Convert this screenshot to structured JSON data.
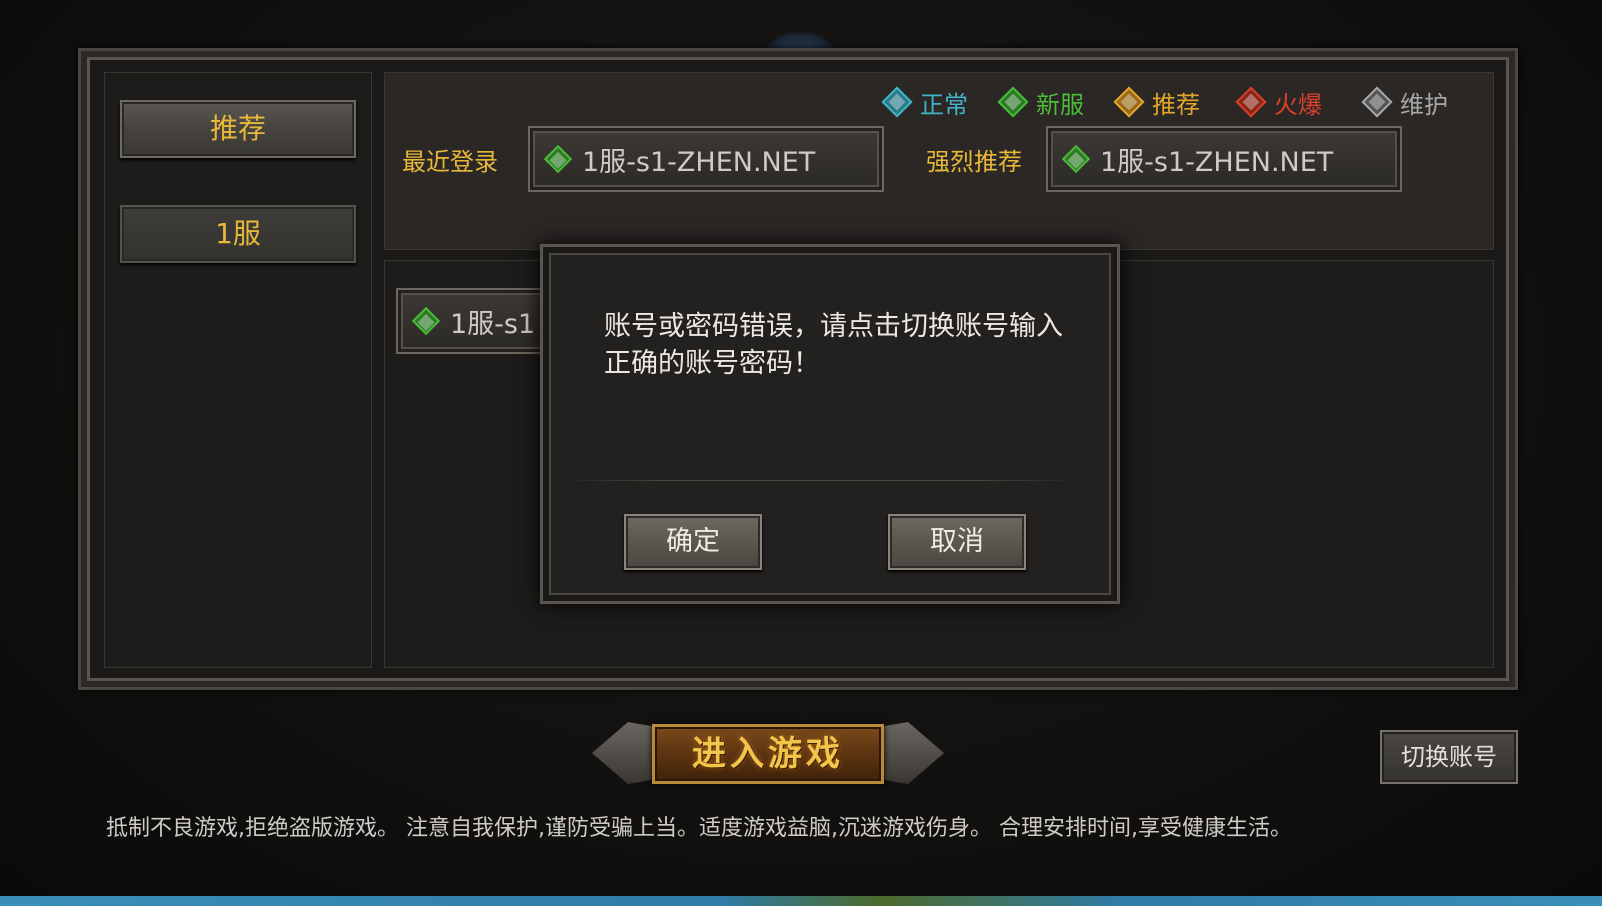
{
  "tabs": [
    {
      "label": "推荐",
      "active": true
    },
    {
      "label": "1服",
      "active": false
    }
  ],
  "legend": [
    {
      "label": "正常",
      "color": "#3fb4c8"
    },
    {
      "label": "新服",
      "color": "#4cbb3a"
    },
    {
      "label": "推荐",
      "color": "#e2a62c"
    },
    {
      "label": "火爆",
      "color": "#d8402a"
    },
    {
      "label": "维护",
      "color": "#a8a8a8"
    }
  ],
  "recent": {
    "label": "最近登录",
    "server": "1服-s1-ZHEN.NET",
    "gem_color": "#4cbb3a"
  },
  "recommend": {
    "label": "强烈推荐",
    "server": "1服-s1-ZHEN.NET",
    "gem_color": "#4cbb3a"
  },
  "server_list": [
    {
      "name": "1服-s1",
      "gem_color": "#4cbb3a"
    }
  ],
  "dialog": {
    "message": "账号或密码错误，请点击切换账号输入正确的账号密码！",
    "confirm_label": "确定",
    "cancel_label": "取消"
  },
  "enter_game_label": "进入游戏",
  "switch_account_label": "切换账号",
  "notice": "抵制不良游戏,拒绝盗版游戏。 注意自我保护,谨防受骗上当。适度游戏益脑,沉迷游戏伤身。 合理安排时间,享受健康生活。"
}
